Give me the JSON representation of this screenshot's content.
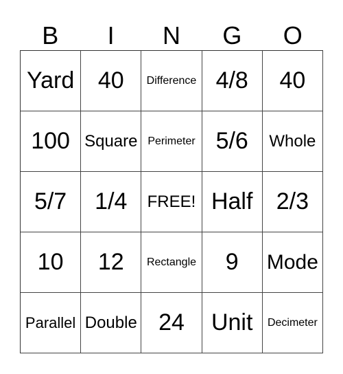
{
  "header": [
    "B",
    "I",
    "N",
    "G",
    "O"
  ],
  "cells": [
    [
      "Yard",
      "40",
      "Difference",
      "4/8",
      "40"
    ],
    [
      "100",
      "Square",
      "Perimeter",
      "5/6",
      "Whole"
    ],
    [
      "5/7",
      "1/4",
      "FREE!",
      "Half",
      "2/3"
    ],
    [
      "10",
      "12",
      "Rectangle",
      "9",
      "Mode"
    ],
    [
      "Parallel",
      "Double",
      "24",
      "Unit",
      "Decimeter"
    ]
  ]
}
